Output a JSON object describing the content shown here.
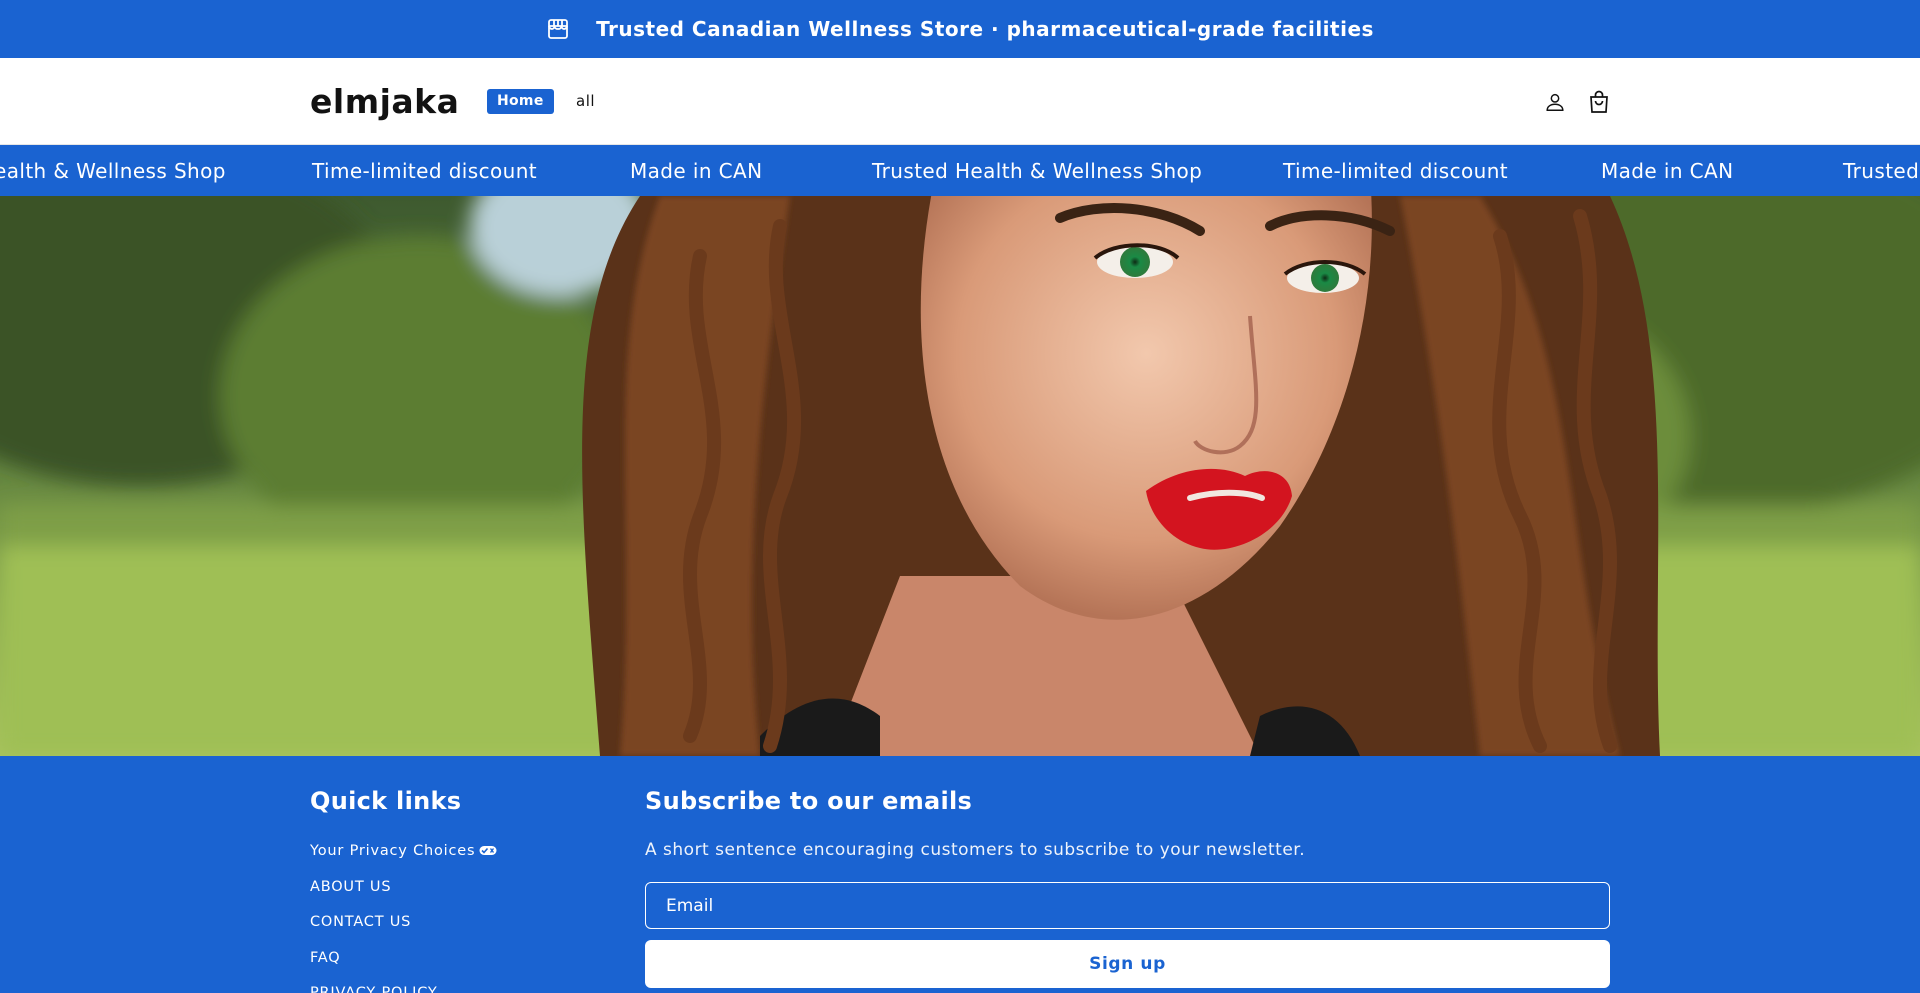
{
  "announcement": {
    "icon": "store-icon",
    "text": "Trusted Canadian Wellness Store · pharmaceutical-grade facilities"
  },
  "header": {
    "logo": "elmjaka",
    "nav": [
      {
        "label": "Home",
        "active": true
      },
      {
        "label": "all",
        "active": false
      }
    ],
    "icons": {
      "account": "account-icon",
      "cart": "cart-icon"
    }
  },
  "marquee": {
    "items": [
      "ealth & Wellness Shop",
      "Time-limited discount",
      "Made in CAN",
      "Trusted Health & Wellness Shop",
      "Time-limited discount",
      "Made in CAN",
      "Trusted"
    ]
  },
  "hero": {
    "image": "woman-portrait-park"
  },
  "footer": {
    "quick_links": {
      "heading": "Quick links",
      "items": [
        "Your Privacy Choices",
        "ABOUT US",
        "CONTACT US",
        "FAQ",
        "PRIVACY POLICY"
      ]
    },
    "newsletter": {
      "heading": "Subscribe to our emails",
      "text": "A short sentence encouraging customers to subscribe to your newsletter.",
      "email_placeholder": "Email",
      "button_label": "Sign up"
    }
  },
  "colors": {
    "brand": "#1a63d1",
    "background": "#ffffff",
    "text": "#121212"
  }
}
